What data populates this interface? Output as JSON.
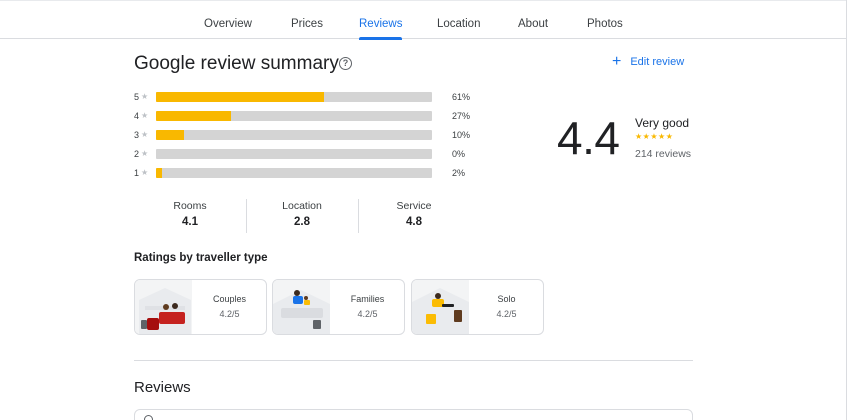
{
  "nav": {
    "tabs": [
      {
        "label": "Overview"
      },
      {
        "label": "Prices"
      },
      {
        "label": "Reviews",
        "active": true
      },
      {
        "label": "Location"
      },
      {
        "label": "About"
      },
      {
        "label": "Photos"
      }
    ]
  },
  "summary": {
    "title": "Google review summary",
    "help_icon": "?",
    "edit_icon": "+",
    "edit_label": "Edit review"
  },
  "distribution": [
    {
      "stars": "5",
      "star_glyph": "★",
      "percent": 61,
      "percent_label": "61%"
    },
    {
      "stars": "4",
      "star_glyph": "★",
      "percent": 27,
      "percent_label": "27%"
    },
    {
      "stars": "3",
      "star_glyph": "★",
      "percent": 10,
      "percent_label": "10%"
    },
    {
      "stars": "2",
      "star_glyph": "★",
      "percent": 0,
      "percent_label": "0%"
    },
    {
      "stars": "1",
      "star_glyph": "★",
      "percent": 2,
      "percent_label": "2%"
    }
  ],
  "overall": {
    "score": "4.4",
    "rating_text": "Very good",
    "stars": "★★★★★",
    "star_value": 4.4,
    "reviews_count": "214 reviews"
  },
  "subratings": [
    {
      "label": "Rooms",
      "value": "4.1"
    },
    {
      "label": "Location",
      "value": "2.8"
    },
    {
      "label": "Service",
      "value": "4.8"
    }
  ],
  "traveller": {
    "heading": "Ratings by traveller type",
    "cards": [
      {
        "label": "Couples",
        "score": "4.2/5",
        "icon": "couples-illustration"
      },
      {
        "label": "Families",
        "score": "4.2/5",
        "icon": "families-illustration"
      },
      {
        "label": "Solo",
        "score": "4.2/5",
        "icon": "solo-illustration"
      }
    ]
  },
  "reviews": {
    "heading": "Reviews"
  },
  "colors": {
    "accent": "#1a73e8",
    "bar_fill": "#f9b800",
    "bar_track": "#d4d4d4"
  }
}
